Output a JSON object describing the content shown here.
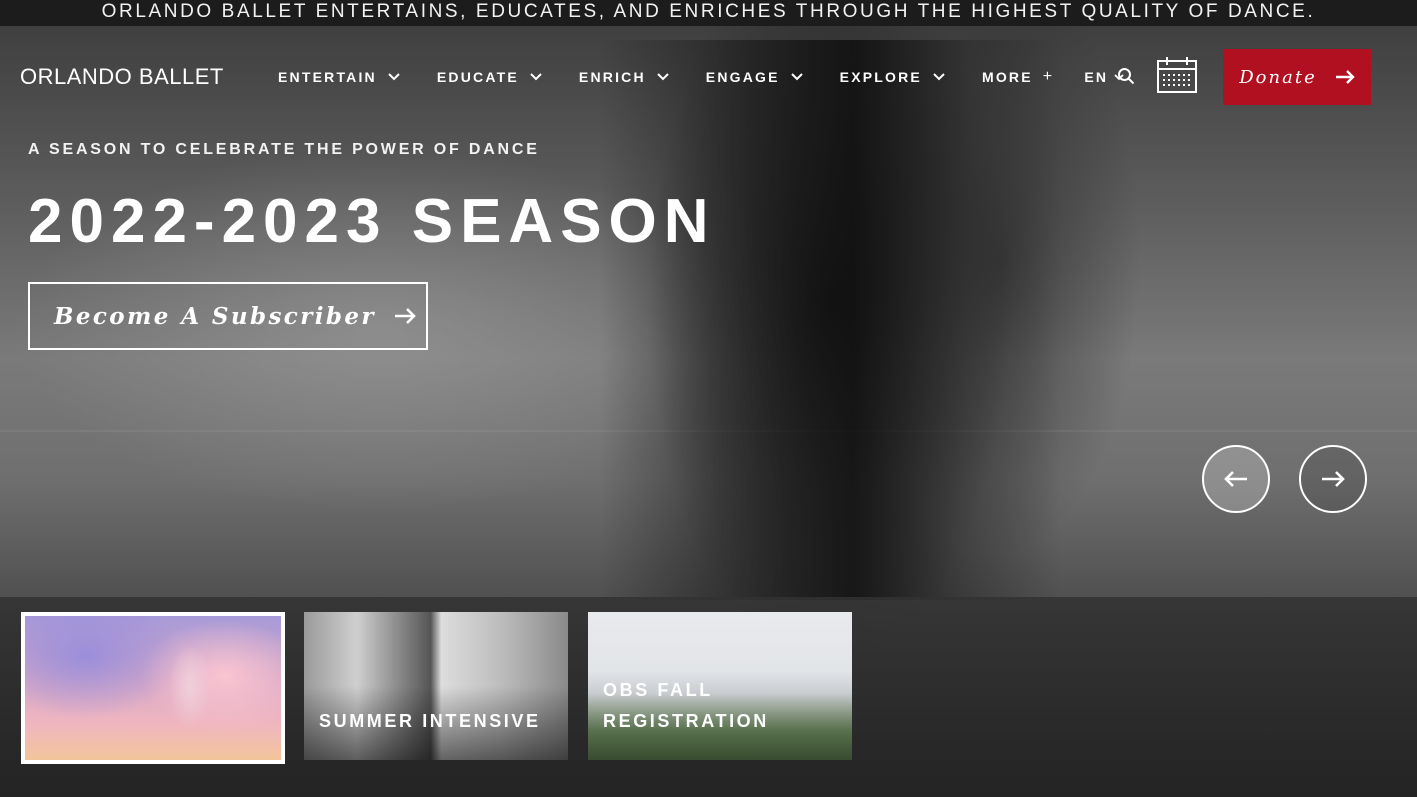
{
  "tagline": "ORLANDO BALLET ENTERTAINS, EDUCATES, AND ENRICHES THROUGH THE HIGHEST QUALITY OF DANCE.",
  "header": {
    "logo_text": "ORLANDO BALLET",
    "nav": [
      {
        "label": "ENTERTAIN"
      },
      {
        "label": "EDUCATE"
      },
      {
        "label": "ENRICH"
      },
      {
        "label": "ENGAGE"
      },
      {
        "label": "EXPLORE"
      }
    ],
    "more_label": "MORE",
    "more_icon": "+",
    "language": "EN",
    "donate_label": "Donate",
    "brand_color": "#b01020"
  },
  "hero": {
    "eyebrow": "A SEASON TO CELEBRATE THE POWER OF DANCE",
    "title": "2022-2023 SEASON",
    "cta_label": "Become A Subscriber"
  },
  "slides": [
    {
      "label": ""
    },
    {
      "label": "SUMMER INTENSIVE"
    },
    {
      "label": "OBS FALL REGISTRATION"
    }
  ]
}
